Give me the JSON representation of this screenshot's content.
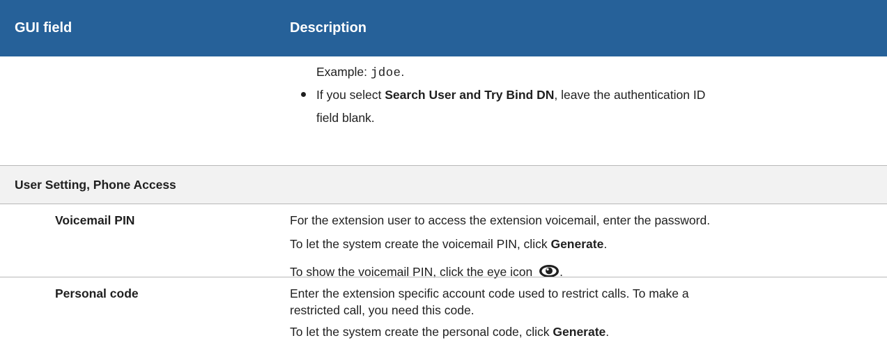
{
  "header": {
    "col1": "GUI field",
    "col2": "Description"
  },
  "row1": {
    "example_label": "Example: ",
    "example_value": "jdoe",
    "example_suffix": ".",
    "bullet_pre": "If you select ",
    "bullet_bold": "Search User and Try Bind DN",
    "bullet_post": ", leave the authentication ID",
    "bullet_line2": "field blank."
  },
  "section": {
    "title": "User Setting, Phone Access"
  },
  "voicemail": {
    "field": "Voicemail PIN",
    "line1": "For the extension user to access the extension voicemail, enter the password.",
    "line2_pre": "To let the system create the voicemail PIN, click ",
    "line2_bold": "Generate",
    "line2_post": ".",
    "line3_pre": "To show the voicemail PIN, click the eye icon ",
    "line3_post": ".",
    "icon": "eye-icon"
  },
  "personal": {
    "field": "Personal code",
    "line1": "Enter the extension specific account code used to restrict calls. To make a",
    "line2": "restricted call, you need this code.",
    "line3_pre": "To let the system create the personal code, click ",
    "line3_bold": "Generate",
    "line3_post": "."
  },
  "colors": {
    "header_bg": "#266199",
    "section_bg": "#f2f2f2",
    "divider": "#b8b8b8"
  }
}
